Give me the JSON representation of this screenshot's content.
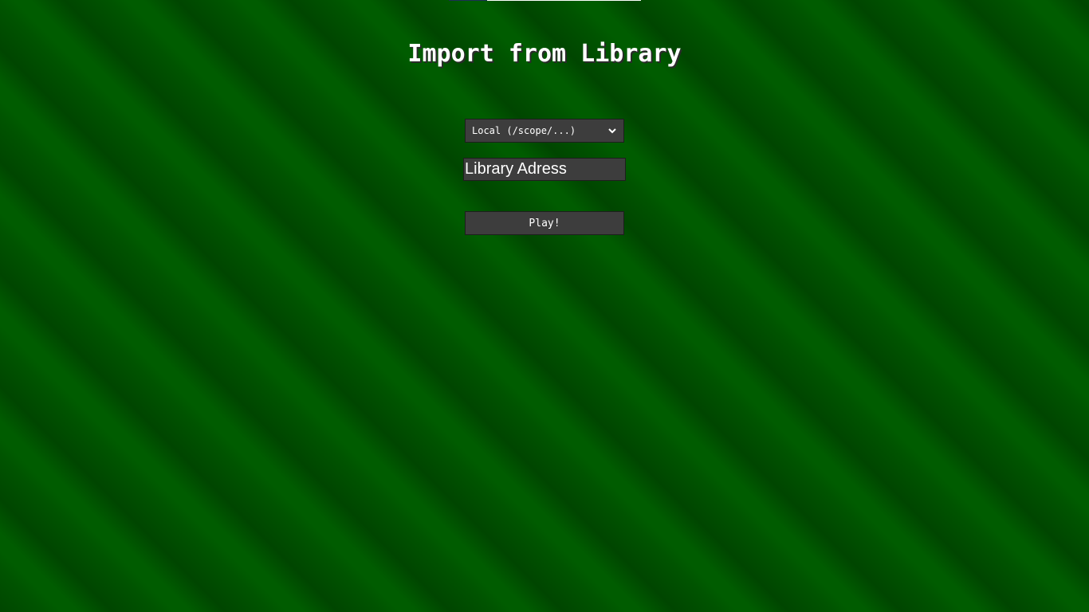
{
  "page": {
    "title": "Import from Library"
  },
  "source_select": {
    "selected": "Local (/scope/...)",
    "icon": "chevron-down-icon"
  },
  "address_input": {
    "value": "",
    "placeholder": "Library Adress"
  },
  "play_button": {
    "label": "Play!"
  },
  "colors": {
    "background_dark": "#004600",
    "background_light": "#005c00",
    "control_background": "#3d3d3d",
    "control_border": "#1e1e1e",
    "text": "#ffffff"
  }
}
